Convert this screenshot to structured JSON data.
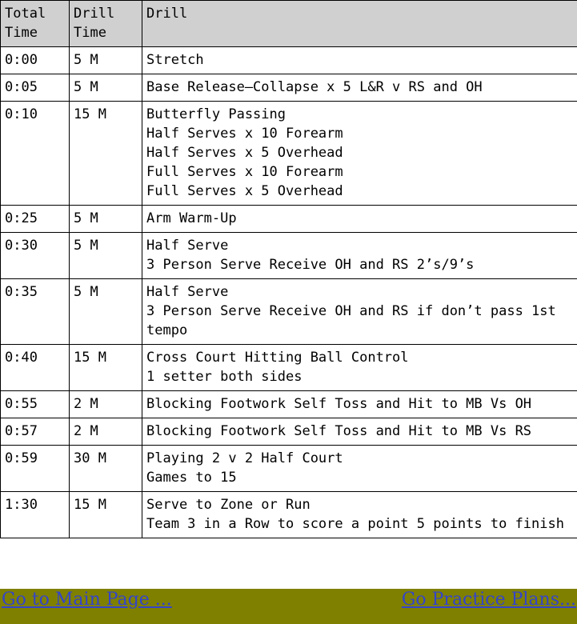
{
  "table": {
    "headers": [
      "Total\nTime",
      "Drill\nTime",
      "Drill"
    ],
    "rows": [
      {
        "total_time": "0:00",
        "drill_time": "5 M",
        "drill": "Stretch"
      },
      {
        "total_time": "0:05",
        "drill_time": "5 M",
        "drill": "Base Release—Collapse x 5 L&R v RS and OH"
      },
      {
        "total_time": "0:10",
        "drill_time": "15 M",
        "drill": "Butterfly Passing\nHalf Serves x 10 Forearm\nHalf Serves x 5 Overhead\nFull Serves x 10 Forearm\nFull Serves x 5 Overhead"
      },
      {
        "total_time": "0:25",
        "drill_time": "5 M",
        "drill": "Arm Warm-Up"
      },
      {
        "total_time": "0:30",
        "drill_time": "5 M",
        "drill": "Half Serve\n3 Person Serve Receive OH and RS 2’s/9’s"
      },
      {
        "total_time": "0:35",
        "drill_time": "5 M",
        "drill": "Half Serve\n3 Person Serve Receive OH and RS if don’t pass 1st tempo"
      },
      {
        "total_time": "0:40",
        "drill_time": "15 M",
        "drill": "Cross Court Hitting Ball Control\n1 setter both sides"
      },
      {
        "total_time": "0:55",
        "drill_time": "2 M",
        "drill": "Blocking Footwork Self Toss and Hit to MB Vs OH"
      },
      {
        "total_time": "0:57",
        "drill_time": "2 M",
        "drill": "Blocking Footwork Self Toss and Hit to MB Vs RS"
      },
      {
        "total_time": "0:59",
        "drill_time": "30 M",
        "drill": "Playing 2 v 2 Half Court\nGames to 15"
      },
      {
        "total_time": "1:30",
        "drill_time": "15 M",
        "drill": "Serve to Zone or Run\nTeam 3 in a Row to score a point 5 points to finish"
      }
    ]
  },
  "footer": {
    "background_color": "#808000",
    "link_color": "#3344cc",
    "left_link": "Go to Main Page ...",
    "right_link": "Go Practice Plans..."
  },
  "colors": {
    "header_background": "#d0d0d0",
    "border": "#000000",
    "text": "#000000"
  }
}
